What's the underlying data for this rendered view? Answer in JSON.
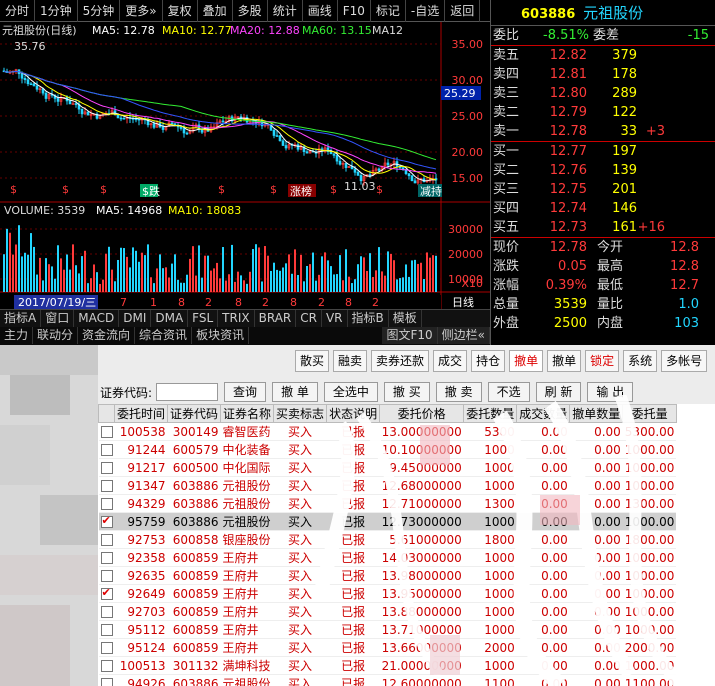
{
  "toolbar": {
    "items": [
      "分时",
      "1分钟",
      "5分钟",
      "更多»",
      "复权",
      "叠加",
      "多股",
      "统计",
      "画线",
      "F10",
      "标记",
      "-自选",
      "返回"
    ]
  },
  "chart": {
    "header_name": "元祖股份(日线)",
    "ma5": "MA5: 12.78",
    "ma10": "MA10: 12.77",
    "ma20": "MA20: 12.88",
    "ma60": "MA60: 13.15",
    "ma120": "MA12",
    "high_label": "35.76",
    "low_label": "11.03",
    "cur_price_tag": "25.29",
    "y_labels": [
      "35.00",
      "30.00",
      "25.00",
      "20.00",
      "15.00"
    ],
    "vol_header": "VOLUME: 3539",
    "vol_ma5": "MA5: 14968",
    "vol_ma10": "MA10: 18083",
    "vol_labels": [
      "30000",
      "20000",
      "10000"
    ],
    "vol_unit": "X10",
    "date_label": "2017/07/19/三",
    "x_months": [
      "7",
      "1",
      "8",
      "2",
      "8",
      "2",
      "8",
      "2",
      "8",
      "2"
    ],
    "period": "日线",
    "marker_zt": "涨榜",
    "marker_jz": "减持"
  },
  "tabs": [
    "指标A",
    "窗口",
    "MACD",
    "DMI",
    "DMA",
    "FSL",
    "TRIX",
    "BRAR",
    "CR",
    "VR",
    "指标B",
    "模板"
  ],
  "tabs2": [
    "主力",
    "联动分",
    "资金流向",
    "综合资讯",
    "板块资讯",
    "图文F10",
    "侧边栏«"
  ],
  "quote": {
    "code": "603886",
    "name": "元祖股份",
    "weibi_label": "委比",
    "weibi": "-8.51%",
    "weicha_label": "委差",
    "weicha": "-15",
    "sell": [
      {
        "label": "卖五",
        "price": "12.82",
        "vol": "379",
        "extra": ""
      },
      {
        "label": "卖四",
        "price": "12.81",
        "vol": "178",
        "extra": ""
      },
      {
        "label": "卖三",
        "price": "12.80",
        "vol": "289",
        "extra": ""
      },
      {
        "label": "卖二",
        "price": "12.79",
        "vol": "122",
        "extra": ""
      },
      {
        "label": "卖一",
        "price": "12.78",
        "vol": "33",
        "extra": "+3"
      }
    ],
    "buy": [
      {
        "label": "买一",
        "price": "12.77",
        "vol": "197",
        "extra": ""
      },
      {
        "label": "买二",
        "price": "12.76",
        "vol": "139",
        "extra": ""
      },
      {
        "label": "买三",
        "price": "12.75",
        "vol": "201",
        "extra": ""
      },
      {
        "label": "买四",
        "price": "12.74",
        "vol": "146",
        "extra": ""
      },
      {
        "label": "买五",
        "price": "12.73",
        "vol": "161",
        "extra": "+16"
      }
    ],
    "stats": [
      {
        "l1": "现价",
        "v1": "12.78",
        "l2": "今开",
        "v2": "12.8"
      },
      {
        "l1": "涨跌",
        "v1": "0.05",
        "l2": "最高",
        "v2": "12.8"
      },
      {
        "l1": "涨幅",
        "v1": "0.39%",
        "l2": "最低",
        "v2": "12.7"
      },
      {
        "l1": "总量",
        "v1": "3539",
        "l2": "量比",
        "v2": "1.0"
      },
      {
        "l1": "外盘",
        "v1": "2500",
        "l2": "内盘",
        "v2": "103"
      }
    ]
  },
  "order_toolbar": [
    "散买",
    "融卖",
    "卖券还款",
    "成交",
    "持仓",
    "撤单",
    "撤单",
    "锁定",
    "系统",
    "多帐号"
  ],
  "filter": {
    "label": "证券代码:",
    "buttons": [
      "查询",
      "撤 单",
      "全选中",
      "撤 买",
      "撤 卖",
      "不选",
      "刷 新",
      "输 出"
    ]
  },
  "grid": {
    "headers": [
      "",
      "委托时间",
      "证券代码",
      "证券名称",
      "买卖标志",
      "状态说明",
      "委托价格",
      "委托数量",
      "成交数量",
      "撤单数量",
      "委托量"
    ],
    "rows": [
      {
        "chk": false,
        "time": "100538",
        "code": "300149",
        "name": "睿智医药",
        "dir": "买入",
        "status": "已报",
        "price": "13.00000000",
        "n1": "5300",
        "n2": "0.00",
        "n3": "0.00",
        "n4": "5300.00"
      },
      {
        "chk": false,
        "time": "91244",
        "code": "600579",
        "name": "中化装备",
        "dir": "买入",
        "status": "已报",
        "price": "10.10000000",
        "n1": "1000",
        "n2": "0.00",
        "n3": "0.00",
        "n4": "1000.00"
      },
      {
        "chk": false,
        "time": "91217",
        "code": "600500",
        "name": "中化国际",
        "dir": "买入",
        "status": "已报",
        "price": "9.45000000",
        "n1": "1000",
        "n2": "0.00",
        "n3": "0.00",
        "n4": "1000.00"
      },
      {
        "chk": false,
        "time": "91347",
        "code": "603886",
        "name": "元祖股份",
        "dir": "买入",
        "status": "已报",
        "price": "12.68000000",
        "n1": "1000",
        "n2": "0.00",
        "n3": "0.00",
        "n4": "1000.00"
      },
      {
        "chk": false,
        "time": "94329",
        "code": "603886",
        "name": "元祖股份",
        "dir": "买入",
        "status": "已报",
        "price": "12.71000000",
        "n1": "1300",
        "n2": "0.00",
        "n3": "0.00",
        "n4": "1300.00"
      },
      {
        "chk": true,
        "time": "95759",
        "code": "603886",
        "name": "元祖股份",
        "dir": "买入",
        "status": "已报",
        "price": "12.73000000",
        "n1": "1000",
        "n2": "0.00",
        "n3": "0.00",
        "n4": "1000.00",
        "sel": true
      },
      {
        "chk": false,
        "time": "92753",
        "code": "600858",
        "name": "银座股份",
        "dir": "买入",
        "status": "已报",
        "price": "5.61000000",
        "n1": "1800",
        "n2": "0.00",
        "n3": "0.00",
        "n4": "1800.00"
      },
      {
        "chk": false,
        "time": "92358",
        "code": "600859",
        "name": "王府井",
        "dir": "买入",
        "status": "已报",
        "price": "14.03000000",
        "n1": "1000",
        "n2": "0.00",
        "n3": "0.00",
        "n4": "1000.00"
      },
      {
        "chk": false,
        "time": "92635",
        "code": "600859",
        "name": "王府井",
        "dir": "买入",
        "status": "已报",
        "price": "13.98000000",
        "n1": "1000",
        "n2": "0.00",
        "n3": "0.00",
        "n4": "1000.00"
      },
      {
        "chk": true,
        "time": "92649",
        "code": "600859",
        "name": "王府井",
        "dir": "买入",
        "status": "已报",
        "price": "13.95000000",
        "n1": "1000",
        "n2": "0.00",
        "n3": "0.00",
        "n4": "1000.00"
      },
      {
        "chk": false,
        "time": "92703",
        "code": "600859",
        "name": "王府井",
        "dir": "买入",
        "status": "已报",
        "price": "13.88000000",
        "n1": "1000",
        "n2": "0.00",
        "n3": "0.00",
        "n4": "1000.00"
      },
      {
        "chk": false,
        "time": "95112",
        "code": "600859",
        "name": "王府井",
        "dir": "买入",
        "status": "已报",
        "price": "13.71000000",
        "n1": "1000",
        "n2": "0.00",
        "n3": "0.00",
        "n4": "1000.00"
      },
      {
        "chk": false,
        "time": "95124",
        "code": "600859",
        "name": "王府井",
        "dir": "买入",
        "status": "已报",
        "price": "13.66000000",
        "n1": "2000",
        "n2": "0.00",
        "n3": "0.00",
        "n4": "2000.00"
      },
      {
        "chk": false,
        "time": "100513",
        "code": "301132",
        "name": "满坤科技",
        "dir": "买入",
        "status": "已报",
        "price": "21.00000000",
        "n1": "1000",
        "n2": "0.00",
        "n3": "0.00",
        "n4": "1000.00"
      },
      {
        "chk": false,
        "time": "94926",
        "code": "603886",
        "name": "元祖股份",
        "dir": "买入",
        "status": "已报",
        "price": "12.60000000",
        "n1": "1100",
        "n2": "0.00",
        "n3": "0.00",
        "n4": "1100.00"
      }
    ]
  },
  "colors": {
    "up": "#ff3a3a",
    "down": "#33ee33",
    "accent": "#ffff00",
    "cyan": "#22d6ff"
  }
}
